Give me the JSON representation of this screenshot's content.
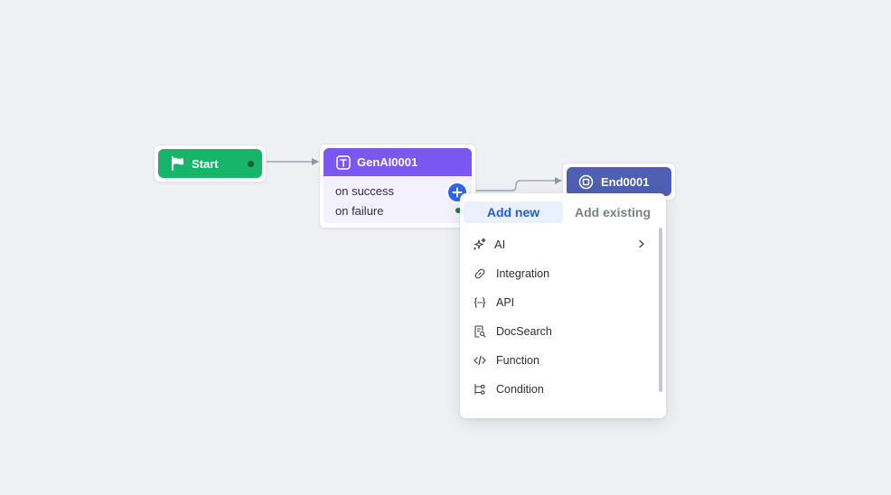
{
  "flow": {
    "start_node": {
      "label": "Start",
      "icon": "flag-icon",
      "color": "#16b56a"
    },
    "genai_node": {
      "label": "GenAI0001",
      "icon": "text-icon",
      "color": "#7b57f2",
      "outcomes": {
        "success": "on success",
        "failure": "on failure"
      }
    },
    "end_node": {
      "label": "End0001",
      "icon": "stop-circle-icon",
      "color": "#4f5fb3"
    }
  },
  "popover": {
    "tabs": {
      "add_new": "Add new",
      "add_existing": "Add existing"
    },
    "active_tab": "Add new",
    "items": [
      {
        "label": "AI",
        "icon": "sparkles-icon",
        "has_submenu": true
      },
      {
        "label": "Integration",
        "icon": "link-icon"
      },
      {
        "label": "API",
        "icon": "api-braces-icon"
      },
      {
        "label": "DocSearch",
        "icon": "doc-search-icon"
      },
      {
        "label": "Function",
        "icon": "code-icon"
      },
      {
        "label": "Condition",
        "icon": "branch-icon"
      }
    ]
  },
  "colors": {
    "canvas_bg": "#eff0f4",
    "accent": "#2f66e6",
    "connector": "#8e97a8"
  }
}
